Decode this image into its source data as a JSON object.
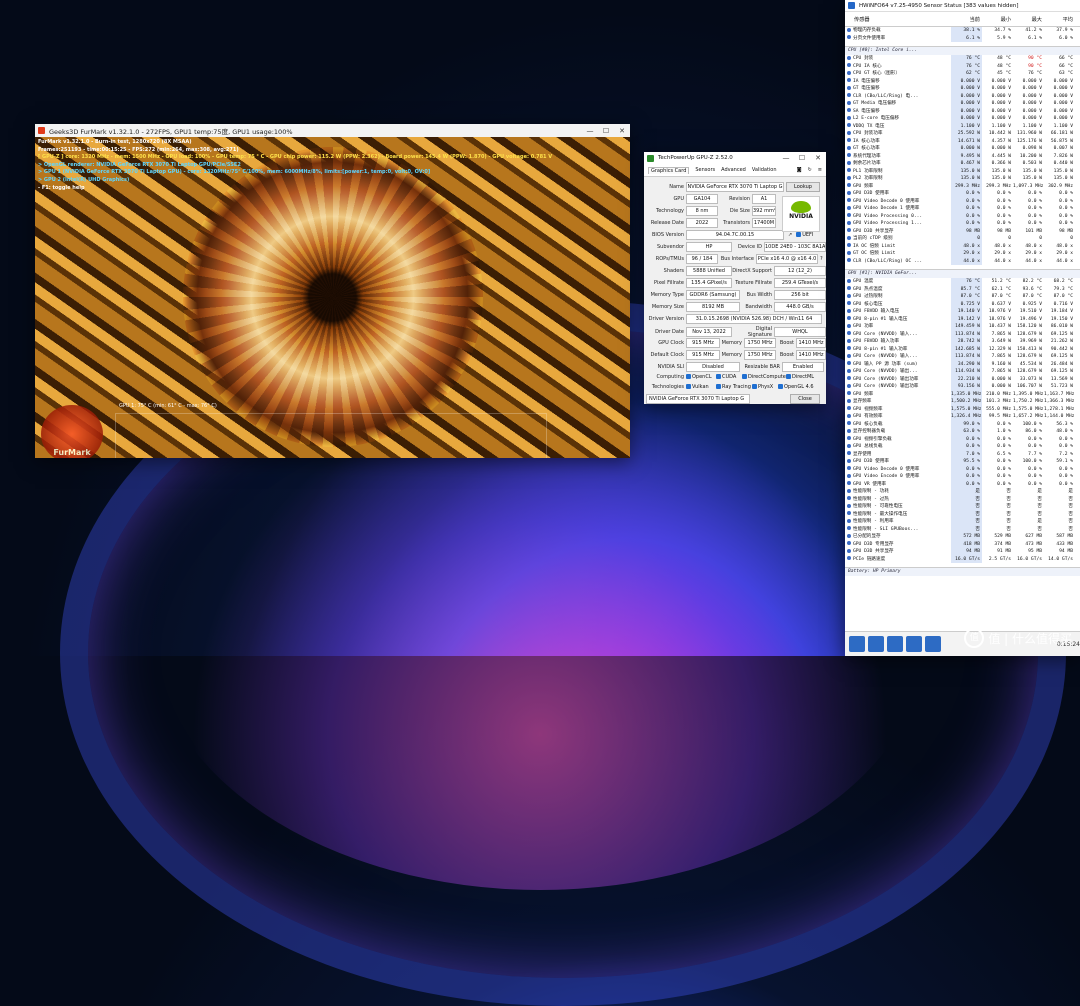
{
  "furmark": {
    "title": "Geeks3D FurMark v1.32.1.0 - 272FPS, GPU1 temp:75度, GPU1 usage:100%",
    "hud": [
      {
        "text": "FurMark v1.32.1.0 - Burn-in test, 1280x720 (8X MSAA)",
        "color": "#ffffff"
      },
      {
        "text": "Frames:251193 - time:00:15:25 - FPS:272 (min:264, max:308, avg:271)",
        "color": "#ffffff"
      },
      {
        "text": "[ GPU-Z ] core: 1320 MHz - mem: 1500 MHz - GPU load: 100% - GPU temp: 75 ° C - GPU chip power: 115.2 W (PPW: 2.362) - Board power: 145.4 W (PPW: 1.870) - GPU voltage: 0.781 V",
        "color": "#ffe14a"
      },
      {
        "text": "> OpenGL renderer: NVIDIA GeForce RTX 3070 Ti Laptop GPU/PCIe/SSE2",
        "color": "#5fd6ff"
      },
      {
        "text": "> GPU 1 (NVIDIA GeForce RTX 3070 Ti Laptop GPU) - core: 1320MHz/75° C/100%, mem: 6000MHz/8%, limits:[power:1, temp:0, volt:0, OV:0]",
        "color": "#5fd6ff"
      },
      {
        "text": "> GPU 2 (Intel(R) UHD Graphics)",
        "color": "#5fd6ff"
      },
      {
        "text": "- F1: toggle help",
        "color": "#ffffff"
      }
    ],
    "gpu_line": "GPU 1: 75° C (min: 61° C - max: 76° C)",
    "logo_text": "FurMark"
  },
  "gpuz": {
    "title": "TechPowerUp GPU-Z 2.52.0",
    "tabs": [
      "Graphics Card",
      "Sensors",
      "Advanced",
      "Validation"
    ],
    "name_label": "Name",
    "name": "NVIDIA GeForce RTX 3070 Ti Laptop G",
    "lookup": "Lookup",
    "gpu_label": "GPU",
    "gpu": "GA104",
    "revision_label": "Revision",
    "revision": "A1",
    "tech_label": "Technology",
    "tech": "8 nm",
    "die_label": "Die Size",
    "die": "392 mm²",
    "release_label": "Release Date",
    "release": "2022",
    "transistors_label": "Transistors",
    "transistors": "17400M",
    "bios_label": "BIOS Version",
    "bios": "94.04.7C.00.15",
    "uefi": "UEFI",
    "subvendor_label": "Subvendor",
    "subvendor": "HP",
    "deviceid_label": "Device ID",
    "deviceid": "10DE 24E0 - 103C 8A1A",
    "rops_label": "ROPs/TMUs",
    "rops": "96 / 184",
    "bus_label": "Bus Interface",
    "bus": "PCIe x16 4.0 @ x16 4.0",
    "shaders_label": "Shaders",
    "shaders": "5888 Unified",
    "dx_label": "DirectX Support",
    "dx": "12 (12_2)",
    "pixel_label": "Pixel Fillrate",
    "pixel": "135.4 GPixel/s",
    "texture_label": "Texture Fillrate",
    "texture": "259.4 GTexel/s",
    "memtype_label": "Memory Type",
    "memtype": "GDDR6 (Samsung)",
    "buswidth_label": "Bus Width",
    "buswidth": "256 bit",
    "memsize_label": "Memory Size",
    "memsize": "8192 MB",
    "bandwidth_label": "Bandwidth",
    "bandwidth": "448.0 GB/s",
    "driver_label": "Driver Version",
    "driver": "31.0.15.2698 (NVIDIA 526.98) DCH / Win11 64",
    "driverdate_label": "Driver Date",
    "driverdate": "Nov 13, 2022",
    "sig_label": "Digital Signature",
    "sig": "WHQL",
    "gpuclock_label": "GPU Clock",
    "gpuclock": "915 MHz",
    "memory_label": "Memory",
    "memclock": "1750 MHz",
    "boost_label": "Boost",
    "boost": "1410 MHz",
    "defclock_label": "Default Clock",
    "defclock": "915 MHz",
    "defmem": "1750 MHz",
    "defboost": "1410 MHz",
    "sli_label": "NVIDIA SLI",
    "sli": "Disabled",
    "rebar_label": "Resizable BAR",
    "rebar": "Enabled",
    "computing_label": "Computing",
    "computing": [
      "OpenCL",
      "CUDA",
      "DirectCompute",
      "DirectML"
    ],
    "technologies_label": "Technologies",
    "technologies": [
      "Vulkan",
      "Ray Tracing",
      "PhysX",
      "OpenGL 4.6"
    ],
    "select": "NVIDIA GeForce RTX 3070 Ti Laptop G",
    "close": "Close",
    "logo_text": "NVIDIA"
  },
  "hwinfo": {
    "title": "HWiNFO64 v7.25-4950 Sensor Status [383 values hidden]",
    "headers": [
      "传感器",
      "当前",
      "最小",
      "最大",
      "平均"
    ],
    "rows_top": [
      {
        "n": "物理内存负载",
        "v": [
          "38.1 %",
          "34.7 %",
          "41.2 %",
          "37.9 %"
        ]
      },
      {
        "n": "分页文件使用率",
        "v": [
          "6.1 %",
          "5.9 %",
          "6.1 %",
          "6.0 %"
        ]
      }
    ],
    "group_cpu": "CPU [#0]: Intel Core i...",
    "rows_cpu": [
      {
        "n": "CPU 封装",
        "v": [
          "76 °C",
          "48 °C",
          "90 °C",
          "66 °C"
        ],
        "r": true
      },
      {
        "n": "CPU IA 核心",
        "v": [
          "76 °C",
          "48 °C",
          "90 °C",
          "66 °C"
        ],
        "r": true
      },
      {
        "n": "CPU GT 核心（图形）",
        "v": [
          "62 °C",
          "45 °C",
          "76 °C",
          "63 °C"
        ]
      },
      {
        "n": "IA 电压偏移",
        "v": [
          "0.000 V",
          "0.000 V",
          "0.000 V",
          "0.000 V"
        ]
      },
      {
        "n": "GT 电压偏移",
        "v": [
          "0.000 V",
          "0.000 V",
          "0.000 V",
          "0.000 V"
        ]
      },
      {
        "n": "CLR (CBo/LLC/Ring) 电...",
        "v": [
          "0.000 V",
          "0.000 V",
          "0.000 V",
          "0.000 V"
        ]
      },
      {
        "n": "GT Media 电压偏移",
        "v": [
          "0.000 V",
          "0.000 V",
          "0.000 V",
          "0.000 V"
        ]
      },
      {
        "n": "SA 电压偏移",
        "v": [
          "0.000 V",
          "0.000 V",
          "0.000 V",
          "0.000 V"
        ]
      },
      {
        "n": "L2 E-core 电压偏移",
        "v": [
          "0.000 V",
          "0.000 V",
          "0.000 V",
          "0.000 V"
        ]
      },
      {
        "n": "VDDQ TX 电压",
        "v": [
          "1.100 V",
          "1.100 V",
          "1.100 V",
          "1.100 V"
        ]
      },
      {
        "n": "CPU 封装功率",
        "v": [
          "25.592 W",
          "10.442 W",
          "131.960 W",
          "66.181 W"
        ]
      },
      {
        "n": "IA 核心功率",
        "v": [
          "14.671 W",
          "4.357 W",
          "125.176 W",
          "56.875 W"
        ]
      },
      {
        "n": "GT 核心功率",
        "v": [
          "0.000 W",
          "0.000 W",
          "0.098 W",
          "0.007 W"
        ]
      },
      {
        "n": "系统代理功率",
        "v": [
          "9.495 W",
          "4.445 W",
          "10.200 W",
          "7.826 W"
        ]
      },
      {
        "n": "剩余芯片功率",
        "v": [
          "0.467 W",
          "0.366 W",
          "0.503 W",
          "0.440 W"
        ]
      },
      {
        "n": "PL1 功率限制",
        "v": [
          "135.0 W",
          "135.0 W",
          "135.0 W",
          "135.0 W"
        ]
      },
      {
        "n": "PL2 功率限制",
        "v": [
          "135.0 W",
          "135.0 W",
          "135.0 W",
          "135.0 W"
        ]
      },
      {
        "n": "GPU 频率",
        "v": [
          "299.3 MHz",
          "299.3 MHz",
          "1,097.3 MHz",
          "302.9 MHz"
        ]
      },
      {
        "n": "GPU D3D 使用率",
        "v": [
          "0.0 %",
          "0.0 %",
          "0.0 %",
          "0.0 %"
        ]
      },
      {
        "n": "GPU Video Decode 0 使用率",
        "v": [
          "0.0 %",
          "0.0 %",
          "0.0 %",
          "0.0 %"
        ]
      },
      {
        "n": "GPU Video Decode 1 使用率",
        "v": [
          "0.0 %",
          "0.0 %",
          "0.0 %",
          "0.0 %"
        ]
      },
      {
        "n": "GPU Video Processing 0...",
        "v": [
          "0.0 %",
          "0.0 %",
          "0.0 %",
          "0.0 %"
        ]
      },
      {
        "n": "GPU Video Processing 1...",
        "v": [
          "0.0 %",
          "0.0 %",
          "0.0 %",
          "0.0 %"
        ]
      },
      {
        "n": "GPU D3D 共享显存",
        "v": [
          "98 MB",
          "98 MB",
          "101 MB",
          "98 MB"
        ]
      },
      {
        "n": "当前的 cTDP 级别",
        "v": [
          "0",
          "0",
          "0",
          "0"
        ]
      },
      {
        "n": "IA OC 倍频 Limit",
        "v": [
          "48.0 x",
          "48.0 x",
          "48.0 x",
          "48.0 x"
        ]
      },
      {
        "n": "GT OC 倍频 Limit",
        "v": [
          "29.0 x",
          "29.0 x",
          "29.0 x",
          "29.0 x"
        ]
      },
      {
        "n": "CLR (CBo/LLC/Ring) OC ...",
        "v": [
          "44.0 x",
          "44.0 x",
          "44.0 x",
          "44.0 x"
        ]
      }
    ],
    "group_gpu": "GPU [#1]: NVIDIA GeFor...",
    "rows_gpu": [
      {
        "n": "GPU 温度",
        "v": [
          "76 °C",
          "51.2 °C",
          "82.2 °C",
          "68.2 °C"
        ]
      },
      {
        "n": "GPU 热点温度",
        "v": [
          "85.7 °C",
          "62.1 °C",
          "93.6 °C",
          "79.3 °C"
        ]
      },
      {
        "n": "GPU 过热限制",
        "v": [
          "87.0 °C",
          "87.0 °C",
          "87.0 °C",
          "87.0 °C"
        ]
      },
      {
        "n": "GPU 核心电压",
        "v": [
          "0.725 V",
          "0.637 V",
          "0.925 V",
          "0.716 V"
        ]
      },
      {
        "n": "GPU FBVDD 输入电压",
        "v": [
          "19.140 V",
          "18.976 V",
          "19.510 V",
          "19.184 V"
        ]
      },
      {
        "n": "GPU 8-pin #1 输入电压",
        "v": [
          "19.142 V",
          "18.976 V",
          "19.496 V",
          "19.150 V"
        ]
      },
      {
        "n": "GPU 功率",
        "v": [
          "149.459 W",
          "10.437 W",
          "158.120 W",
          "86.010 W"
        ]
      },
      {
        "n": "GPU Core (NVVDD) 输入...",
        "v": [
          "113.874 W",
          "7.865 W",
          "128.679 W",
          "69.125 W"
        ]
      },
      {
        "n": "GPU FBVDD 输入功率",
        "v": [
          "28.742 W",
          "3.649 W",
          "39.969 W",
          "21.262 W"
        ]
      },
      {
        "n": "GPU 8-pin #1 输入功率",
        "v": [
          "142.685 W",
          "12.329 W",
          "158.413 W",
          "90.442 W"
        ]
      },
      {
        "n": "GPU Core (NVVDD) 输入...",
        "v": [
          "113.874 W",
          "7.865 W",
          "128.679 W",
          "69.125 W"
        ]
      },
      {
        "n": "GPU 输入 PP 源 功率 (sum)",
        "v": [
          "34.290 W",
          "9.160 W",
          "45.534 W",
          "26.484 W"
        ]
      },
      {
        "n": "GPU Core (NVVDD) 输出...",
        "v": [
          "114.934 W",
          "7.865 W",
          "128.679 W",
          "69.125 W"
        ]
      },
      {
        "n": "GPU Core (NVVDD) 输出功率",
        "v": [
          "22.210 W",
          "0.000 W",
          "33.073 W",
          "13.569 W"
        ]
      },
      {
        "n": "GPU Core (NVVDD) 输出功率",
        "v": [
          "93.156 W",
          "0.000 W",
          "106.707 W",
          "51.723 W"
        ]
      },
      {
        "n": "GPU 频率",
        "v": [
          "1,335.0 MHz",
          "210.0 MHz",
          "1,395.0 MHz",
          "1,163.7 MHz"
        ]
      },
      {
        "n": "显存频率",
        "v": [
          "1,500.2 MHz",
          "101.3 MHz",
          "1,750.2 MHz",
          "1,366.3 MHz"
        ]
      },
      {
        "n": "GPU 视频频率",
        "v": [
          "1,575.0 MHz",
          "555.0 MHz",
          "1,575.0 MHz",
          "1,278.1 MHz"
        ]
      },
      {
        "n": "GPU 有效频率",
        "v": [
          "1,326.4 MHz",
          "99.5 MHz",
          "1,657.2 MHz",
          "1,144.0 MHz"
        ]
      },
      {
        "n": "GPU 核心负载",
        "v": [
          "99.0 %",
          "0.0 %",
          "100.0 %",
          "56.3 %"
        ]
      },
      {
        "n": "显存控制器负载",
        "v": [
          "63.0 %",
          "1.0 %",
          "86.0 %",
          "48.0 %"
        ]
      },
      {
        "n": "GPU 视频引擎负载",
        "v": [
          "0.0 %",
          "0.0 %",
          "0.0 %",
          "0.0 %"
        ]
      },
      {
        "n": "GPU 总线负载",
        "v": [
          "0.0 %",
          "0.0 %",
          "0.0 %",
          "0.0 %"
        ]
      },
      {
        "n": "显存使用",
        "v": [
          "7.0 %",
          "6.5 %",
          "7.7 %",
          "7.2 %"
        ]
      },
      {
        "n": "GPU D3D 使用率",
        "v": [
          "95.5 %",
          "0.0 %",
          "100.0 %",
          "59.1 %"
        ]
      },
      {
        "n": "GPU Video Decode 0 使用率",
        "v": [
          "0.0 %",
          "0.0 %",
          "0.0 %",
          "0.0 %"
        ]
      },
      {
        "n": "GPU Video Encode 0 使用率",
        "v": [
          "0.0 %",
          "0.0 %",
          "0.0 %",
          "0.0 %"
        ]
      },
      {
        "n": "GPU VR 使用率",
        "v": [
          "0.0 %",
          "0.0 %",
          "0.0 %",
          "0.0 %"
        ]
      },
      {
        "n": "性能限制 - 功耗",
        "v": [
          "是",
          "否",
          "是",
          "是"
        ]
      },
      {
        "n": "性能限制 - 过热",
        "v": [
          "否",
          "否",
          "否",
          "否"
        ]
      },
      {
        "n": "性能限制 - 可靠性电压",
        "v": [
          "否",
          "否",
          "否",
          "否"
        ]
      },
      {
        "n": "性能限制 - 最大操作电压",
        "v": [
          "否",
          "否",
          "否",
          "否"
        ]
      },
      {
        "n": "性能限制 - 利用率",
        "v": [
          "否",
          "否",
          "是",
          "否"
        ]
      },
      {
        "n": "性能限制 - SLI GPUBoos...",
        "v": [
          "否",
          "否",
          "否",
          "否"
        ]
      },
      {
        "n": "已分配的显存",
        "v": [
          "572 MB",
          "529 MB",
          "627 MB",
          "587 MB"
        ]
      },
      {
        "n": "GPU D3D 专用显存",
        "v": [
          "418 MB",
          "374 MB",
          "473 MB",
          "433 MB"
        ]
      },
      {
        "n": "GPU D3D 共享显存",
        "v": [
          "94 MB",
          "91 MB",
          "95 MB",
          "94 MB"
        ]
      },
      {
        "n": "PCIe 链路速度",
        "v": [
          "16.0 GT/s",
          "2.5 GT/s",
          "16.0 GT/s",
          "14.0 GT/s"
        ]
      }
    ],
    "group_battery": "Battery: HP Primary",
    "clock": "0:15:24"
  },
  "watermark": "值 | 什么值得买",
  "colors": {
    "accent": "#2d6bc4",
    "highlight": "#dbe5f7",
    "alert": "#d01818"
  }
}
